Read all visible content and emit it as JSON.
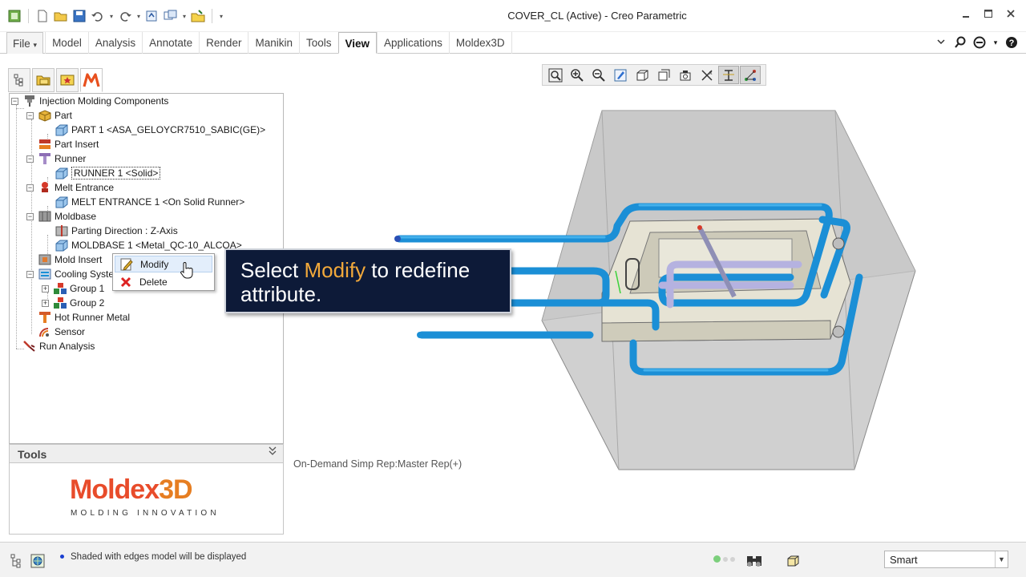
{
  "window": {
    "title": "COVER_CL (Active) - Creo Parametric"
  },
  "quick_access": {
    "icons": [
      "app-icon",
      "new-icon",
      "open-icon",
      "save-icon",
      "undo-icon",
      "redo-icon",
      "regenerate-icon",
      "windows-icon",
      "close-window-icon",
      "customize-icon"
    ]
  },
  "ribbon": {
    "tabs": [
      {
        "label": "File",
        "active": false
      },
      {
        "label": "Model",
        "active": false
      },
      {
        "label": "Analysis",
        "active": false
      },
      {
        "label": "Annotate",
        "active": false
      },
      {
        "label": "Render",
        "active": false
      },
      {
        "label": "Manikin",
        "active": false
      },
      {
        "label": "Tools",
        "active": false
      },
      {
        "label": "View",
        "active": true
      },
      {
        "label": "Applications",
        "active": false
      },
      {
        "label": "Moldex3D",
        "active": false
      }
    ],
    "file_arrow": "▾"
  },
  "tree": {
    "items": [
      {
        "label": "Injection Molding Components",
        "icon": "mold-components-icon"
      },
      {
        "label": "Part",
        "icon": "part-icon"
      },
      {
        "label": "PART 1 <ASA_GELOYCR7510_SABIC(GE)>",
        "icon": "solid-cube-icon"
      },
      {
        "label": "Part Insert",
        "icon": "part-insert-icon"
      },
      {
        "label": "Runner",
        "icon": "runner-icon"
      },
      {
        "label": "RUNNER 1 <Solid>",
        "icon": "solid-cube-icon"
      },
      {
        "label": "Melt Entrance",
        "icon": "melt-entrance-icon"
      },
      {
        "label": "MELT ENTRANCE 1 <On Solid Runner>",
        "icon": "solid-cube-icon"
      },
      {
        "label": "Moldbase",
        "icon": "moldbase-icon"
      },
      {
        "label": "Parting Direction : Z-Axis",
        "icon": "parting-direction-icon"
      },
      {
        "label": "MOLDBASE 1 <Metal_QC-10_ALCOA>",
        "icon": "solid-cube-icon"
      },
      {
        "label": "Mold Insert",
        "icon": "mold-insert-icon"
      },
      {
        "label": "Cooling System",
        "icon": "cooling-system-icon"
      },
      {
        "label": "Group 1",
        "icon": "group-icon"
      },
      {
        "label": "Group 2",
        "icon": "group-icon"
      },
      {
        "label": "Hot Runner Metal",
        "icon": "hot-runner-icon"
      },
      {
        "label": "Sensor",
        "icon": "sensor-icon"
      },
      {
        "label": "Run Analysis",
        "icon": "run-analysis-icon"
      }
    ]
  },
  "context_menu": {
    "items": [
      {
        "label": "Modify",
        "icon": "modify-icon",
        "highlighted": true
      },
      {
        "label": "Delete",
        "icon": "delete-icon",
        "highlighted": false
      }
    ]
  },
  "tools_panel": {
    "header": "Tools",
    "logo_main_a": "Moldex",
    "logo_main_b": "3D",
    "logo_sub": "MOLDING INNOVATION"
  },
  "graphics": {
    "toolbar_icons": [
      "refit-icon",
      "zoom-in-icon",
      "zoom-out-icon",
      "repaint-icon",
      "display-style-icon",
      "saved-orientations-icon",
      "view-manager-icon",
      "perspective-icon",
      "datum-display-icon",
      "annotation-display-icon",
      "spin-center-icon"
    ],
    "simp_rep": "On-Demand Simp Rep:Master Rep(+)"
  },
  "callout": {
    "text_before": "Select ",
    "highlight": "Modify",
    "text_after": " to redefine attribute."
  },
  "status_bar": {
    "message": "Shaded with edges model will be displayed",
    "filter_value": "Smart"
  },
  "colors": {
    "cooling_channel": "#1b8fd6",
    "callout_bg": "#0d1a38",
    "callout_highlight": "#f2a93b",
    "brand_red": "#e84c2b"
  }
}
